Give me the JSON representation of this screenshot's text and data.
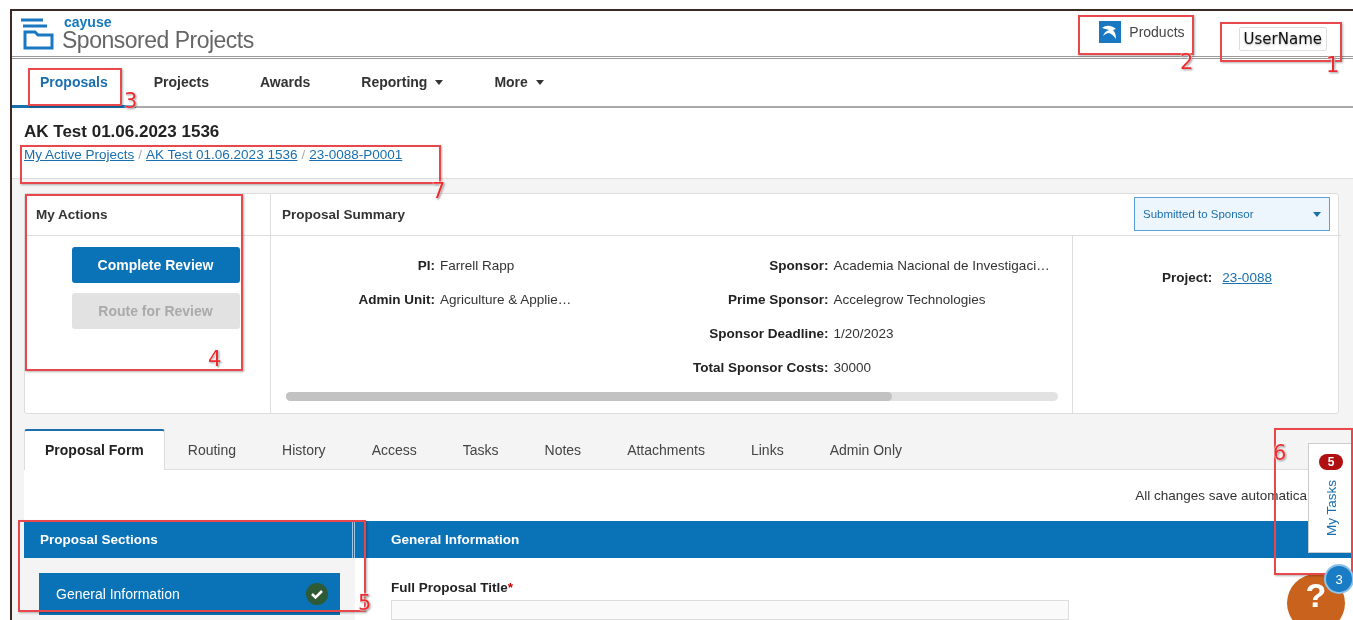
{
  "header": {
    "brand": "cayuse",
    "product": "Sponsored Projects",
    "products_link": "Products",
    "user": "UserName"
  },
  "nav": [
    {
      "label": "Proposals",
      "selected": true,
      "dropdown": false
    },
    {
      "label": "Projects",
      "selected": false,
      "dropdown": false
    },
    {
      "label": "Awards",
      "selected": false,
      "dropdown": false
    },
    {
      "label": "Reporting",
      "selected": false,
      "dropdown": true
    },
    {
      "label": "More",
      "selected": false,
      "dropdown": true
    }
  ],
  "page": {
    "title": "AK Test 01.06.2023 1536",
    "breadcrumbs": [
      "My Active Projects",
      "AK Test 01.06.2023 1536",
      "23-0088-P0001"
    ],
    "breadcrumb_separator": "/"
  },
  "my_actions": {
    "title": "My Actions",
    "buttons": [
      {
        "label": "Complete Review",
        "disabled": false
      },
      {
        "label": "Route for Review",
        "disabled": true
      }
    ]
  },
  "proposal_summary": {
    "title": "Proposal Summary",
    "status": "Submitted to Sponsor",
    "left_fields": [
      {
        "label": "PI:",
        "value": "Farrell Rapp"
      },
      {
        "label": "Admin Unit:",
        "value": "Agriculture & Applie…"
      }
    ],
    "right_fields": [
      {
        "label": "Sponsor:",
        "value": "Academia Nacional de Investigaci…"
      },
      {
        "label": "Prime Sponsor:",
        "value": "Accelegrow Technologies"
      },
      {
        "label": "Sponsor Deadline:",
        "value": "1/20/2023"
      },
      {
        "label": "Total Sponsor Costs:",
        "value": "30000"
      }
    ],
    "project": {
      "label": "Project:",
      "value": "23-0088"
    }
  },
  "tabs": [
    {
      "label": "Proposal Form",
      "selected": true
    },
    {
      "label": "Routing",
      "selected": false
    },
    {
      "label": "History",
      "selected": false
    },
    {
      "label": "Access",
      "selected": false
    },
    {
      "label": "Tasks",
      "selected": false
    },
    {
      "label": "Notes",
      "selected": false
    },
    {
      "label": "Attachments",
      "selected": false
    },
    {
      "label": "Links",
      "selected": false
    },
    {
      "label": "Admin Only",
      "selected": false
    }
  ],
  "save_note": "All changes save automatica",
  "proposal_sections": {
    "title": "Proposal Sections",
    "items": [
      {
        "label": "General Information",
        "selected": true,
        "complete": true
      }
    ]
  },
  "section": {
    "title": "General Information",
    "fields": [
      {
        "label": "Full Proposal Title",
        "required": true,
        "required_mark": "*"
      }
    ]
  },
  "my_tasks": {
    "label": "My Tasks",
    "count": "5"
  },
  "help": {
    "label": "?",
    "badge": "3"
  },
  "annotations": [
    {
      "number": "1"
    },
    {
      "number": "2"
    },
    {
      "number": "3"
    },
    {
      "number": "4"
    },
    {
      "number": "5"
    },
    {
      "number": "6"
    },
    {
      "number": "7"
    }
  ]
}
